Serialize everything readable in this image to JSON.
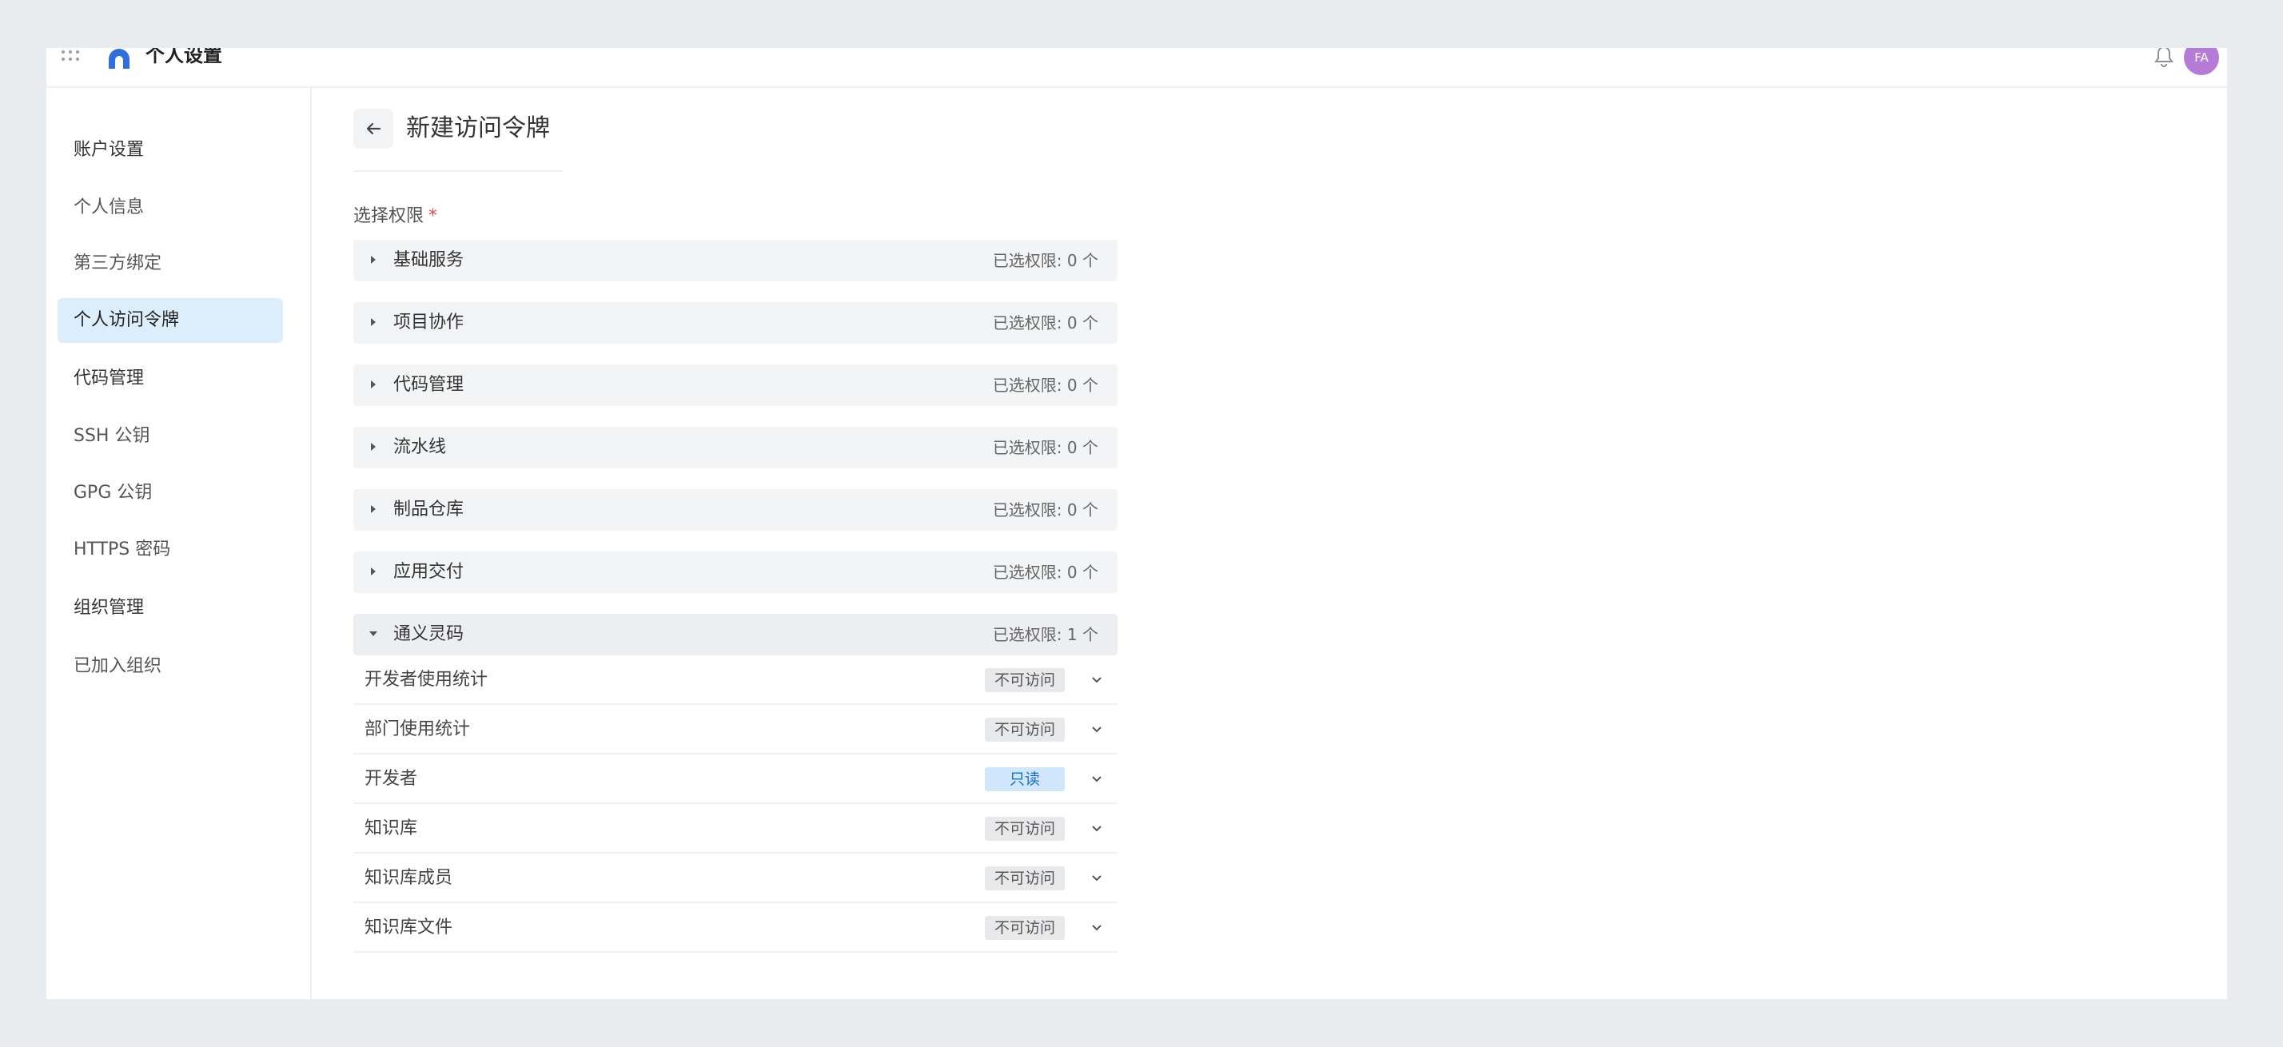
{
  "header": {
    "title": "个人设置",
    "avatar_initials": "FA",
    "icons": [
      "apps-grid-icon",
      "logo-icon",
      "bell-icon"
    ]
  },
  "sidebar": {
    "items": [
      {
        "label": "账户设置",
        "type": "group"
      },
      {
        "label": "个人信息",
        "type": "item"
      },
      {
        "label": "第三方绑定",
        "type": "item"
      },
      {
        "label": "个人访问令牌",
        "type": "item",
        "active": true
      },
      {
        "label": "代码管理",
        "type": "group"
      },
      {
        "label": "SSH 公钥",
        "type": "item"
      },
      {
        "label": "GPG 公钥",
        "type": "item"
      },
      {
        "label": "HTTPS 密码",
        "type": "item"
      },
      {
        "label": "组织管理",
        "type": "group"
      },
      {
        "label": "已加入组织",
        "type": "item"
      }
    ]
  },
  "main": {
    "title": "新建访问令牌",
    "permissions_label": "选择权限",
    "required_mark": "*",
    "sections": [
      {
        "name": "基础服务",
        "count": "已选权限: 0 个"
      },
      {
        "name": "项目协作",
        "count": "已选权限: 0 个"
      },
      {
        "name": "代码管理",
        "count": "已选权限: 0 个"
      },
      {
        "name": "流水线",
        "count": "已选权限: 0 个"
      },
      {
        "name": "制品仓库",
        "count": "已选权限: 0 个"
      },
      {
        "name": "应用交付",
        "count": "已选权限: 0 个"
      },
      {
        "name": "通义灵码",
        "count": "已选权限: 1 个",
        "expanded": true
      }
    ],
    "expanded_rows": [
      {
        "label": "开发者使用统计",
        "value": "不可访问"
      },
      {
        "label": "部门使用统计",
        "value": "不可访问"
      },
      {
        "label": "开发者",
        "value": "只读"
      },
      {
        "label": "知识库",
        "value": "不可访问"
      },
      {
        "label": "知识库成员",
        "value": "不可访问"
      },
      {
        "label": "知识库文件",
        "value": "不可访问"
      }
    ]
  },
  "colors": {
    "active_bg": "#dcedfb",
    "read_badge_bg": "#cfe6fb",
    "read_badge_text": "#1b6fc4",
    "avatar": "#b57bd6",
    "required": "#e5484d"
  }
}
